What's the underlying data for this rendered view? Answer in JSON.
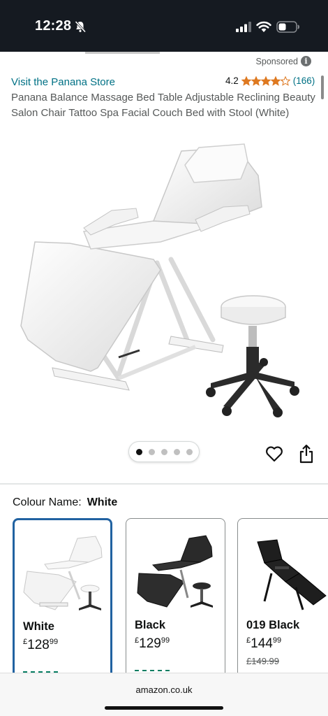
{
  "status_bar": {
    "time": "12:28"
  },
  "sponsored_label": "Sponsored",
  "store_link": "Visit the Panana Store",
  "rating": {
    "value": "4.2",
    "stars": 4.2,
    "count": "(166)"
  },
  "product_title": "Panana Balance Massage Bed Table Adjustable Reclining Beauty Salon Chair Tattoo Spa Facial Couch Bed with Stool (White)",
  "carousel": {
    "total": 5,
    "active": 1
  },
  "colour": {
    "label": "Colour Name:",
    "value": "White"
  },
  "swatches": [
    {
      "name": "White",
      "currency": "£",
      "whole": "128",
      "fraction": "99",
      "was": "",
      "selected": true,
      "color": "#f4f4f4"
    },
    {
      "name": "Black",
      "currency": "£",
      "whole": "129",
      "fraction": "99",
      "was": "",
      "selected": false,
      "color": "#2a2a2a"
    },
    {
      "name": "019 Black",
      "currency": "£",
      "whole": "144",
      "fraction": "99",
      "was": "£149.99",
      "selected": false,
      "color": "#1e1e1e"
    }
  ],
  "browser": {
    "url": "amazon.co.uk"
  },
  "colors": {
    "link": "#007185",
    "star": "#de7921",
    "selected_border": "#2162a1",
    "status_bar": "#151a21"
  }
}
